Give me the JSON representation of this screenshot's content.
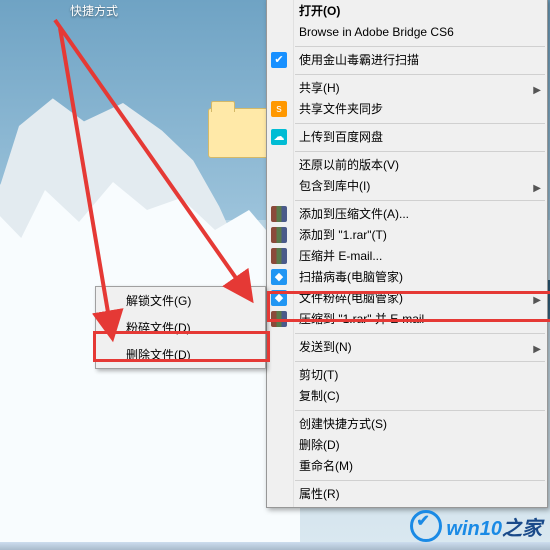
{
  "window": {
    "title_fragment": "快捷方式"
  },
  "submenu": {
    "items": [
      {
        "label": "解锁文件(G)"
      },
      {
        "label": "粉碎文件(D)"
      },
      {
        "label": "删除文件(D)"
      }
    ]
  },
  "menu": {
    "groups": [
      {
        "items": [
          {
            "label": "打开(O)"
          },
          {
            "label": "Browse in Adobe Bridge CS6"
          }
        ]
      },
      {
        "items": [
          {
            "label": "使用金山毒霸进行扫描",
            "icon": "shield-check-icon"
          }
        ]
      },
      {
        "items": [
          {
            "label": "共享(H)",
            "submenu": true
          },
          {
            "label": "共享文件夹同步",
            "icon": "sync-icon"
          }
        ]
      },
      {
        "items": [
          {
            "label": "上传到百度网盘",
            "icon": "cloud-icon"
          }
        ]
      },
      {
        "items": [
          {
            "label": "还原以前的版本(V)"
          },
          {
            "label": "包含到库中(I)",
            "submenu": true
          }
        ]
      },
      {
        "items": [
          {
            "label": "添加到压缩文件(A)...",
            "icon": "winrar-icon"
          },
          {
            "label": "添加到 \"1.rar\"(T)",
            "icon": "winrar-icon"
          },
          {
            "label": "压缩并 E-mail...",
            "icon": "winrar-icon"
          },
          {
            "label": "扫描病毒(电脑管家)",
            "icon": "qq-guard-icon"
          },
          {
            "label": "文件粉碎(电脑管家)",
            "icon": "qq-guard-icon",
            "submenu": true
          },
          {
            "label": "压缩到 \"1.rar\" 并 E-mail",
            "icon": "winrar-icon"
          }
        ]
      },
      {
        "items": [
          {
            "label": "发送到(N)",
            "submenu": true
          }
        ]
      },
      {
        "items": [
          {
            "label": "剪切(T)"
          },
          {
            "label": "复制(C)"
          }
        ]
      },
      {
        "items": [
          {
            "label": "创建快捷方式(S)"
          },
          {
            "label": "删除(D)"
          },
          {
            "label": "重命名(M)"
          }
        ]
      },
      {
        "items": [
          {
            "label": "属性(R)"
          }
        ]
      }
    ]
  },
  "annotations": {
    "highlight_targets": [
      "文件粉碎(电脑管家)",
      "删除文件(D)"
    ],
    "color": "#e53935"
  },
  "watermark": {
    "brand": "win10",
    "suffix": "之家"
  },
  "colors": {
    "menu_bg": "#f0f0f0",
    "menu_border": "#979797",
    "highlight": "#e53935",
    "brand_blue": "#1a8ae5"
  }
}
